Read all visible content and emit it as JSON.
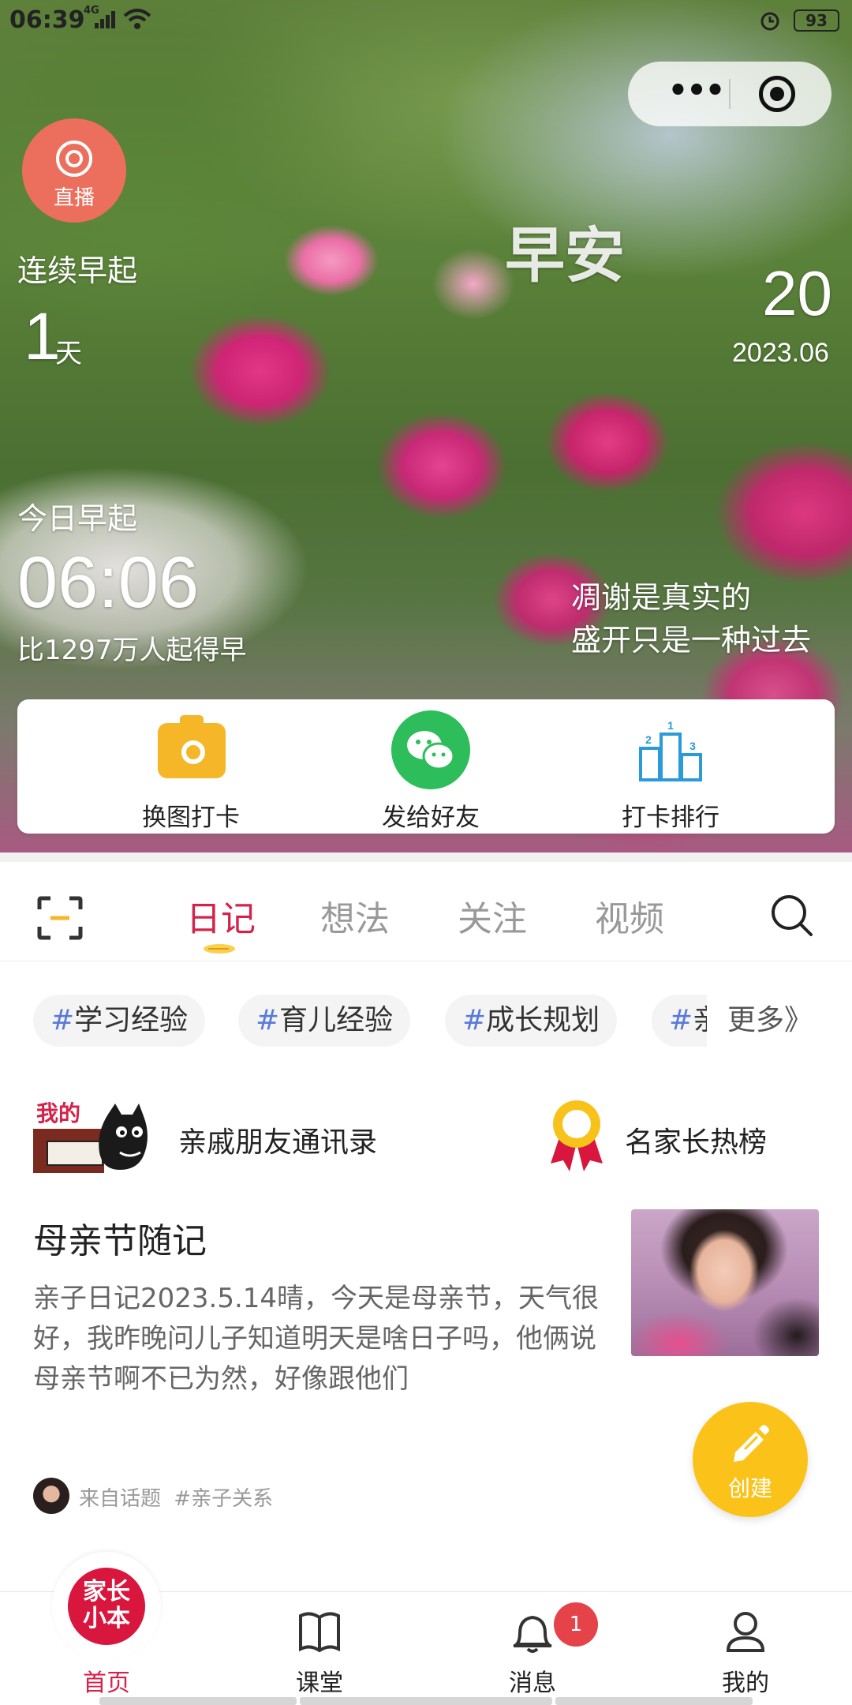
{
  "status_bar": {
    "time": "06:39",
    "network": "4G",
    "battery": "93"
  },
  "hero": {
    "live_label": "直播",
    "greeting": "早安",
    "streak_label": "连续早起",
    "streak_days": "1",
    "streak_unit": "天",
    "date_day": "20",
    "date_year_month": "2023.06",
    "today_label": "今日早起",
    "today_time": "06:06",
    "compare_text": "比1297万人起得早",
    "quote_line1": "凋谢是真实的",
    "quote_line2": "盛开只是一种过去"
  },
  "actions": {
    "change_photo": "换图打卡",
    "send_friend": "发给好友",
    "ranking": "打卡排行"
  },
  "tabs": [
    {
      "label": "日记",
      "active": true
    },
    {
      "label": "想法",
      "active": false
    },
    {
      "label": "关注",
      "active": false
    },
    {
      "label": "视频",
      "active": false
    }
  ],
  "topics": {
    "items": [
      "学习经验",
      "育儿经验",
      "成长规划",
      "亲"
    ],
    "hash": "#",
    "more": "更多》"
  },
  "shortcuts": {
    "contacts_badge": "我的",
    "contacts": "亲戚朋友通讯录",
    "ranking": "名家长热榜"
  },
  "post": {
    "title": "母亲节随记",
    "excerpt": "亲子日记2023.5.14晴，今天是母亲节，天气很好，我昨晚问儿子知道明天是啥日子吗，他俩说母亲节啊不已为然，好像跟他们",
    "source": "来自话题",
    "topic": "#亲子关系"
  },
  "create_button": "创建",
  "bottom_nav": {
    "logo_line1": "家长",
    "logo_line2": "小本",
    "home": "首页",
    "class": "课堂",
    "messages": "消息",
    "messages_badge": "1",
    "me": "我的"
  },
  "colors": {
    "accent": "#d4224a",
    "create": "#fbc31a",
    "live": "#ec6f5e",
    "wechat": "#2dbd5a",
    "hashtag": "#5a7ad8"
  }
}
